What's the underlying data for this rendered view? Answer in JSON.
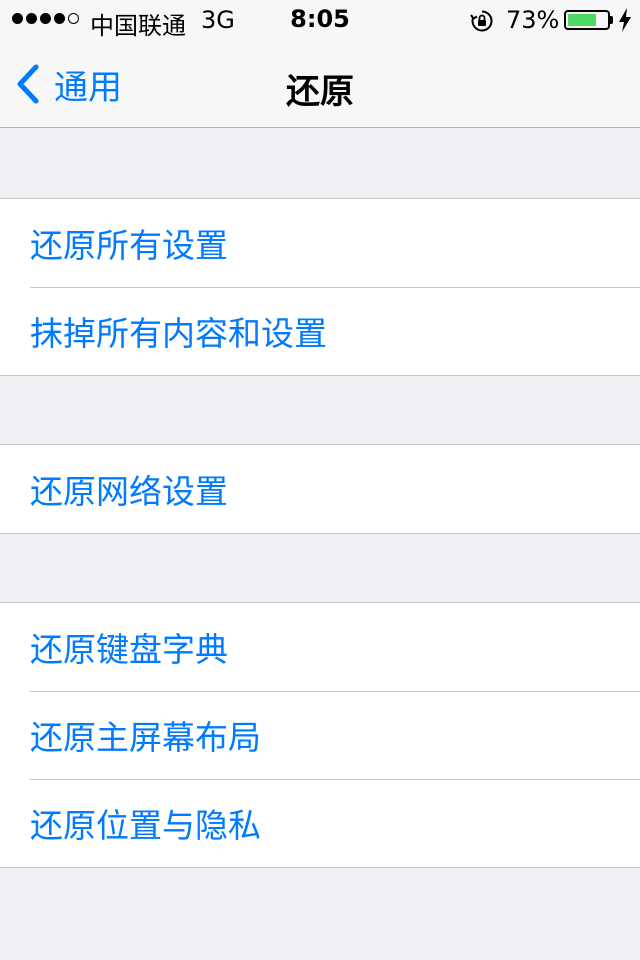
{
  "status_bar": {
    "carrier": "中国联通",
    "network": "3G",
    "time": "8:05",
    "battery_percent": "73%",
    "battery_level": 0.73,
    "signal_strength": 4,
    "signal_max": 5,
    "battery_color": "#4cd964"
  },
  "nav_bar": {
    "back_label": "通用",
    "title": "还原"
  },
  "groups": [
    {
      "items": [
        {
          "label": "还原所有设置"
        },
        {
          "label": "抹掉所有内容和设置"
        }
      ]
    },
    {
      "items": [
        {
          "label": "还原网络设置"
        }
      ]
    },
    {
      "items": [
        {
          "label": "还原键盘字典"
        },
        {
          "label": "还原主屏幕布局"
        },
        {
          "label": "还原位置与隐私"
        }
      ]
    }
  ],
  "colors": {
    "accent": "#007aff",
    "background": "#efeff4"
  },
  "icons": {
    "back": "chevron-left-icon",
    "orientation_lock": "orientation-lock-icon",
    "charging": "charging-bolt-icon"
  }
}
